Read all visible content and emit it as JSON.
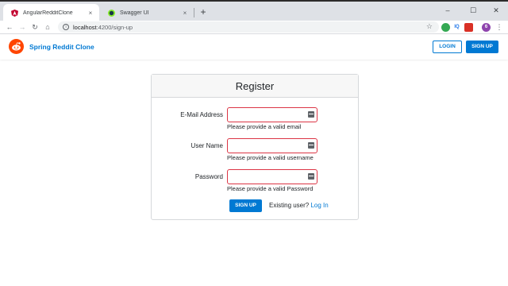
{
  "browser": {
    "tabs": [
      {
        "title": "AngularRedditClone",
        "close": "×",
        "active": true
      },
      {
        "title": "Swagger UI",
        "close": "×",
        "active": false
      }
    ],
    "new_tab": "+",
    "window_controls": {
      "minimize": "–",
      "maximize": "☐",
      "close": "✕"
    },
    "url_host": "localhost",
    "url_path": ":4200/sign-up",
    "nav": {
      "back": "←",
      "forward": "→",
      "reload": "↻",
      "home": "⌂"
    },
    "extensions": [
      {
        "label": "",
        "color": "#34a853"
      },
      {
        "label": "IQ",
        "color": "#1a73e8"
      },
      {
        "label": "",
        "color": "#d93025"
      },
      {
        "label": "6",
        "color": "#8e44ad"
      }
    ],
    "menu": "⋮",
    "star": "☆"
  },
  "navbar": {
    "brand": "Spring Reddit Clone",
    "login_label": "LOGIN",
    "signup_label": "SIGN UP",
    "brand_color": "#0079d3",
    "logo_color": "#ff4500"
  },
  "form": {
    "title": "Register",
    "fields": [
      {
        "label": "E-Mail Address",
        "value": "",
        "error": "Please provide a valid email"
      },
      {
        "label": "User Name",
        "value": "",
        "error": "Please provide a valid username"
      },
      {
        "label": "Password",
        "value": "",
        "error": "Please provide a valid Password"
      }
    ],
    "submit_label": "SIGN UP",
    "existing_text": "Existing user?",
    "login_link": "Log In",
    "error_border_color": "#dc3545"
  }
}
